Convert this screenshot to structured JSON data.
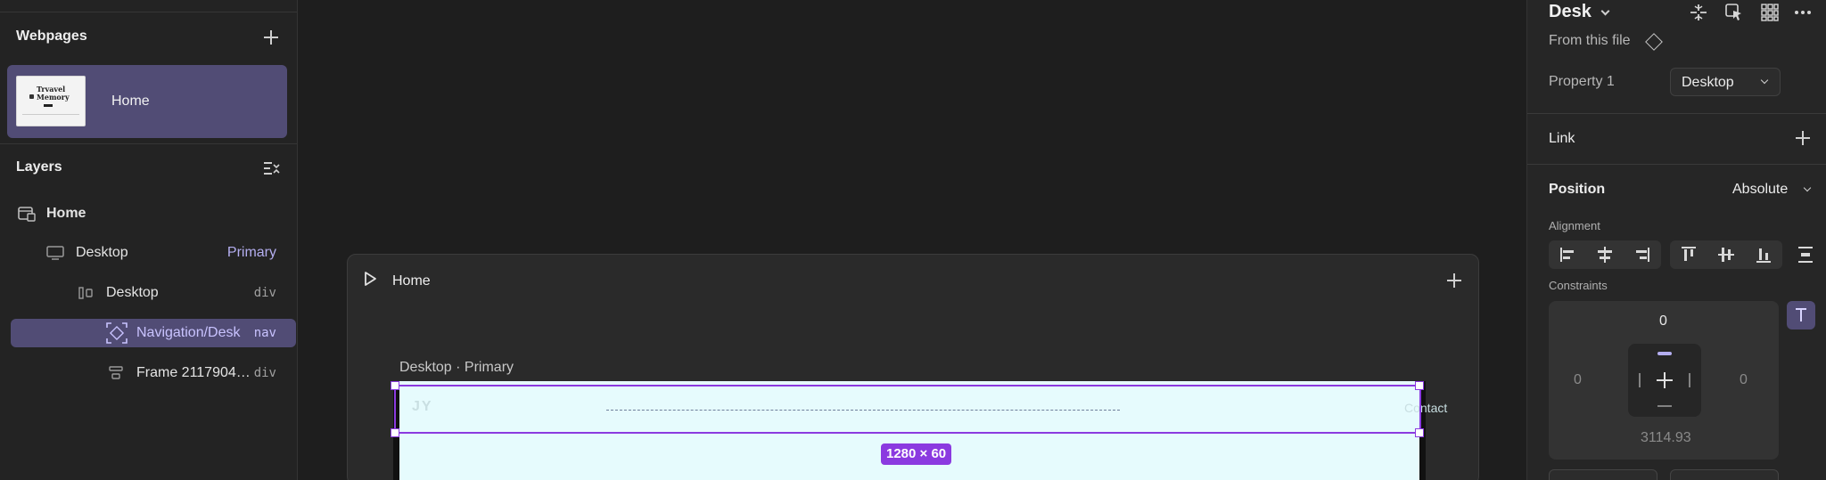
{
  "left_panel": {
    "webpages": {
      "title": "Webpages",
      "pages": [
        {
          "label": "Home",
          "thumb_text": "Trvavel Memory"
        }
      ]
    },
    "layers": {
      "title": "Layers",
      "items": [
        {
          "label": "Home",
          "tag": "",
          "icon": "page-icon"
        },
        {
          "label": "Desktop",
          "tag": "Primary",
          "icon": "monitor-icon"
        },
        {
          "label": "Desktop",
          "tag": "div",
          "icon": "stack-icon"
        },
        {
          "label": "Navigation/Desk",
          "tag": "nav",
          "icon": "component-icon"
        },
        {
          "label": "Frame 2117904…",
          "tag": "div",
          "icon": "frame-icon"
        }
      ]
    }
  },
  "canvas": {
    "frame_title": "Home",
    "breakpoint_label": "Desktop · Primary",
    "nav_logo": "JY",
    "nav_right": "Contact",
    "size_badge": "1280 × 60"
  },
  "right_panel": {
    "component_name": "Desk",
    "from_file": "From this file",
    "property_label": "Property 1",
    "property_value": "Desktop",
    "link_label": "Link",
    "position_label": "Position",
    "position_value": "Absolute",
    "alignment_label": "Alignment",
    "constraints_label": "Constraints",
    "constraints": {
      "top": "0",
      "left": "0",
      "right": "0",
      "bottom": "3114.93"
    }
  },
  "colors": {
    "accent": "#8b3ae0",
    "selection": "#514c75",
    "primary_tag": "#b4aef0"
  }
}
